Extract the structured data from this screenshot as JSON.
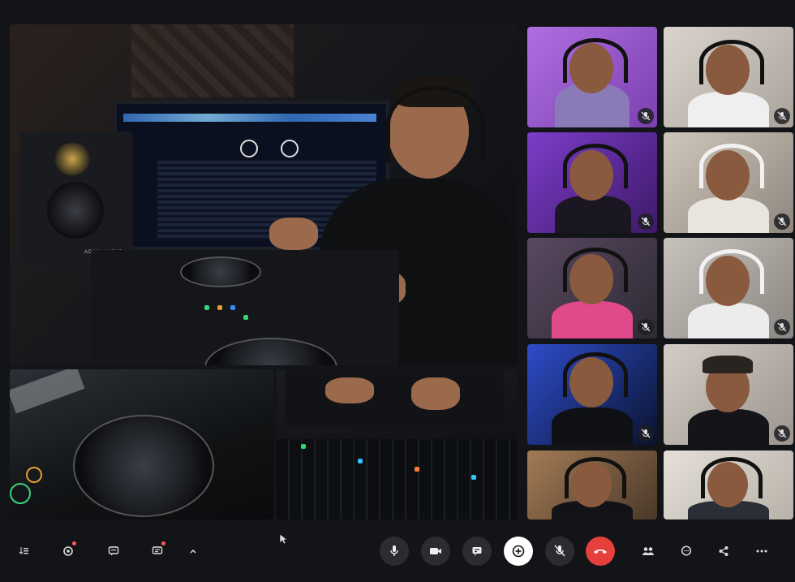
{
  "meeting": {
    "main_label": "",
    "icons": {
      "captions": "captions-icon",
      "hand": "raise-hand-icon",
      "present": "present-icon",
      "reactions": "reactions-icon",
      "more_left": "chevron-up-icon",
      "mic": "microphone-icon",
      "camera": "camera-icon",
      "chat_share": "screen-share-icon",
      "add": "add-icon",
      "mute_all": "mic-off-icon",
      "hangup": "phone-hangup-icon",
      "people": "people-icon",
      "chat": "chat-icon",
      "share": "share-icon",
      "more": "more-icon"
    },
    "colors": {
      "background": "#121418",
      "hangup": "#e5403c",
      "notification": "#ff5a5a",
      "button": "#2a2c31"
    }
  },
  "participants": [
    {
      "id": "p1",
      "muted": true
    },
    {
      "id": "p2",
      "muted": true
    },
    {
      "id": "p3",
      "muted": true
    },
    {
      "id": "p4",
      "muted": true
    },
    {
      "id": "p5",
      "muted": true
    },
    {
      "id": "p6",
      "muted": true
    },
    {
      "id": "p7",
      "muted": true
    },
    {
      "id": "p8",
      "muted": true
    },
    {
      "id": "p9",
      "muted": false
    },
    {
      "id": "p10",
      "muted": false
    }
  ],
  "speaker_branding": "ADAM AUDIO"
}
